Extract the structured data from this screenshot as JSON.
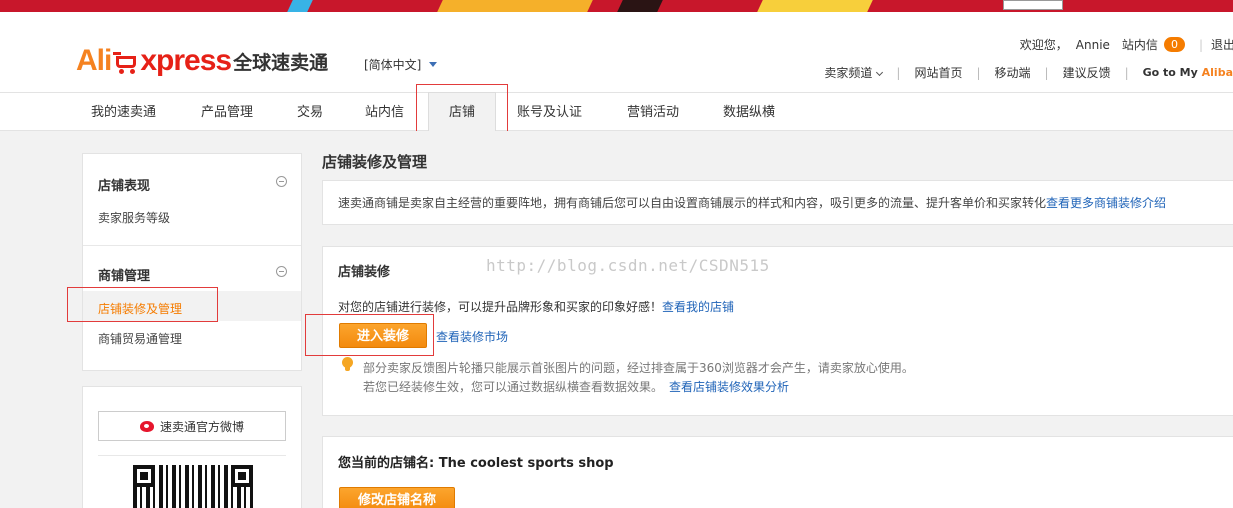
{
  "header": {
    "logo": {
      "ali": "Ali",
      "xpress": "xpress",
      "cn": "全球速卖通"
    },
    "language": "[简体中文]",
    "user": {
      "welcome": "欢迎您，",
      "name": "Annie",
      "messages_label": "站内信",
      "messages_count": "0",
      "logout": "退出"
    },
    "links": [
      {
        "label": "卖家频道",
        "has_dropdown": true
      },
      {
        "label": "网站首页"
      },
      {
        "label": "移动端"
      },
      {
        "label": "建议反馈"
      }
    ],
    "goto": {
      "prefix": "Go to My ",
      "brand": "Aliba"
    }
  },
  "nav": {
    "tabs": [
      {
        "label": "我的速卖通"
      },
      {
        "label": "产品管理"
      },
      {
        "label": "交易"
      },
      {
        "label": "站内信"
      },
      {
        "label": "店铺",
        "active": true
      },
      {
        "label": "账号及认证"
      },
      {
        "label": "营销活动"
      },
      {
        "label": "数据纵横"
      }
    ]
  },
  "sidebar": {
    "sections": [
      {
        "title": "店铺表现",
        "items": [
          "卖家服务等级"
        ]
      },
      {
        "title": "商铺管理",
        "items": [
          "店铺装修及管理",
          "商铺贸易通管理"
        ]
      }
    ],
    "weibo_label": "速卖通官方微博"
  },
  "main": {
    "title": "店铺装修及管理",
    "intro_text": "速卖通商铺是卖家自主经营的重要阵地，拥有商铺后您可以自由设置商铺展示的样式和内容，吸引更多的流量、提升客单价和买家转化",
    "intro_link": "查看更多商铺装修介绍",
    "decoration": {
      "title": "店铺装修",
      "desc": "对您的店铺进行装修，可以提升品牌形象和买家的印象好感！",
      "desc_link": "查看我的店铺",
      "enter_button": "进入装修",
      "market_link": "查看装修市场",
      "tip1": "部分卖家反馈图片轮播只能展示首张图片的问题，经过排查属于360浏览器才会产生，请卖家放心使用。",
      "tip2": "若您已经装修生效，您可以通过数据纵横查看数据效果。",
      "tip2_link": "查看店铺装修效果分析"
    },
    "shop": {
      "name_label": "您当前的店铺名: The coolest sports shop",
      "rename_button": "修改店铺名称"
    },
    "watermark": "http://blog.csdn.net/CSDN515"
  }
}
